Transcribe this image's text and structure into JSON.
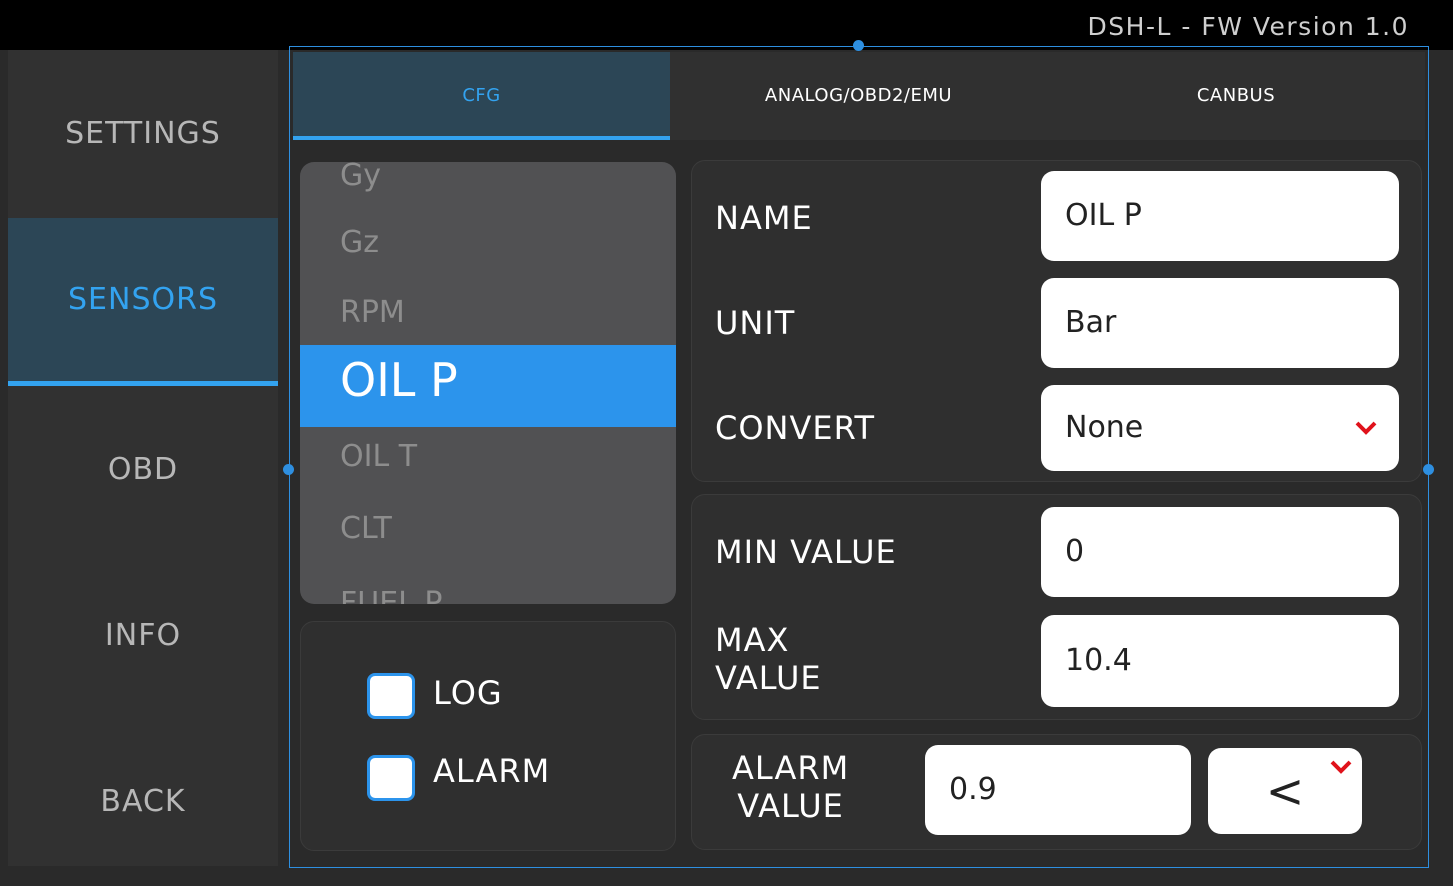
{
  "header": {
    "firmware": "DSH-L - FW Version 1.0"
  },
  "sidebar": {
    "items": [
      {
        "label": "SETTINGS"
      },
      {
        "label": "SENSORS"
      },
      {
        "label": "OBD"
      },
      {
        "label": "INFO"
      },
      {
        "label": "BACK"
      }
    ],
    "active": "SENSORS"
  },
  "tabs": [
    {
      "label": "CFG"
    },
    {
      "label": "ANALOG/OBD2/EMU"
    },
    {
      "label": "CANBUS"
    }
  ],
  "sensor_list": {
    "items": [
      "Gy",
      "Gz",
      "RPM",
      "OIL P",
      "OIL T",
      "CLT",
      "FUEL P"
    ],
    "selected": "OIL P"
  },
  "options": {
    "log_label": "LOG",
    "alarm_label": "ALARM"
  },
  "form": {
    "name_label": "NAME",
    "name_value": "OIL P",
    "unit_label": "UNIT",
    "unit_value": "Bar",
    "convert_label": "CONVERT",
    "convert_value": "None",
    "min_label": "MIN VALUE",
    "min_value": "0",
    "max_label_line1": "MAX",
    "max_label_line2": "VALUE",
    "max_value": "10.4",
    "alarm_label_line1": "ALARM",
    "alarm_label_line2": "VALUE",
    "alarm_value": "0.9",
    "alarm_operator": "<"
  },
  "colors": {
    "accent": "#33a3f0",
    "selected_row": "#2c94ec",
    "chevron": "#e0121b"
  }
}
